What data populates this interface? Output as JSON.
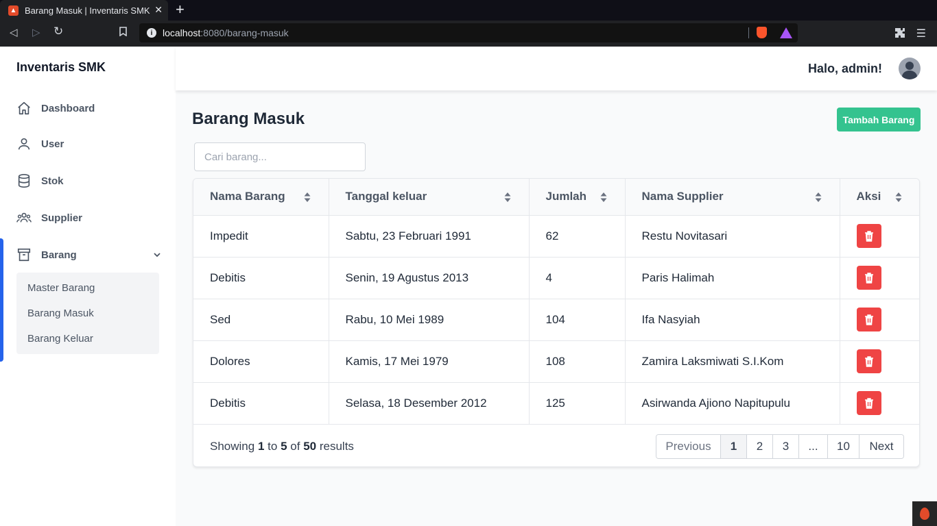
{
  "browser": {
    "tab_title": "Barang Masuk | Inventaris SMK",
    "tab_close": "✕",
    "new_tab": "+",
    "url_host": "localhost",
    "url_rest": ":8080/barang-masuk"
  },
  "app": {
    "brand": "Inventaris SMK",
    "greeting": "Halo, admin!"
  },
  "sidebar": {
    "items": [
      {
        "label": "Dashboard",
        "icon": "home-icon"
      },
      {
        "label": "User",
        "icon": "user-icon"
      },
      {
        "label": "Stok",
        "icon": "database-icon"
      },
      {
        "label": "Supplier",
        "icon": "users-icon"
      },
      {
        "label": "Barang",
        "icon": "archive-icon"
      }
    ],
    "sub_items": [
      {
        "label": "Master Barang"
      },
      {
        "label": "Barang Masuk"
      },
      {
        "label": "Barang Keluar"
      }
    ],
    "accent_color": "#2563eb"
  },
  "main": {
    "title": "Barang Masuk",
    "add_button": "Tambah Barang",
    "add_button_color": "#34c38f",
    "search_placeholder": "Cari barang..."
  },
  "table": {
    "columns": [
      "Nama Barang",
      "Tanggal keluar",
      "Jumlah",
      "Nama Supplier",
      "Aksi"
    ],
    "rows": [
      {
        "nama": "Impedit",
        "tanggal": "Sabtu, 23 Februari 1991",
        "jumlah": "62",
        "supplier": "Restu Novitasari"
      },
      {
        "nama": "Debitis",
        "tanggal": "Senin, 19 Agustus 2013",
        "jumlah": "4",
        "supplier": "Paris Halimah"
      },
      {
        "nama": "Sed",
        "tanggal": "Rabu, 10 Mei 1989",
        "jumlah": "104",
        "supplier": "Ifa Nasyiah"
      },
      {
        "nama": "Dolores",
        "tanggal": "Kamis, 17 Mei 1979",
        "jumlah": "108",
        "supplier": "Zamira Laksmiwati S.I.Kom"
      },
      {
        "nama": "Debitis",
        "tanggal": "Selasa, 18 Desember 2012",
        "jumlah": "125",
        "supplier": "Asirwanda Ajiono Napitupulu"
      }
    ],
    "delete_color": "#ef4444"
  },
  "pagination": {
    "showing": "Showing",
    "from": "1",
    "to_word": "to",
    "to": "5",
    "of_word": "of",
    "total": "50",
    "results_word": "results",
    "previous": "Previous",
    "pages": [
      "1",
      "2",
      "3",
      "...",
      "10"
    ],
    "next": "Next",
    "current": "1"
  }
}
